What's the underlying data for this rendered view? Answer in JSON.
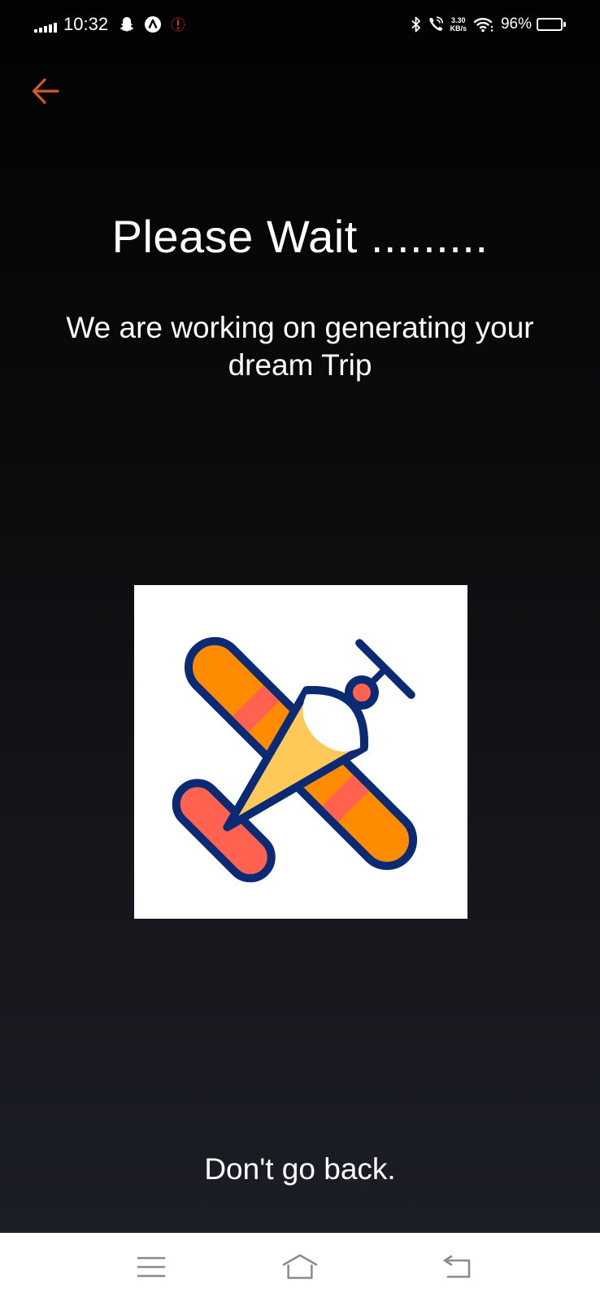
{
  "status_bar": {
    "time": "10:32",
    "net_speed_value": "3.30",
    "net_speed_unit": "KB/s",
    "battery_percent": "96%",
    "battery_level": 0.96,
    "icons": [
      "signal-icon",
      "snapchat-icon",
      "app-a-icon",
      "notification-icon",
      "bluetooth-icon",
      "wifi-calling-icon",
      "wifi-icon",
      "battery-icon"
    ]
  },
  "header": {
    "back_icon": "arrow-left-icon",
    "accent_color": "#d2592a"
  },
  "main": {
    "title": "Please Wait .........",
    "subtitle": "We are working on generating your dream Trip",
    "image_icon": "airplane-icon",
    "footer_message": "Don't go back."
  },
  "nav_bar": {
    "icons": [
      "menu-icon",
      "home-icon",
      "back-icon"
    ]
  },
  "colors": {
    "plane_outline": "#0a2a73",
    "plane_orange": "#ff8c00",
    "plane_coral": "#ff6350",
    "plane_yellow": "#ffc95a"
  }
}
